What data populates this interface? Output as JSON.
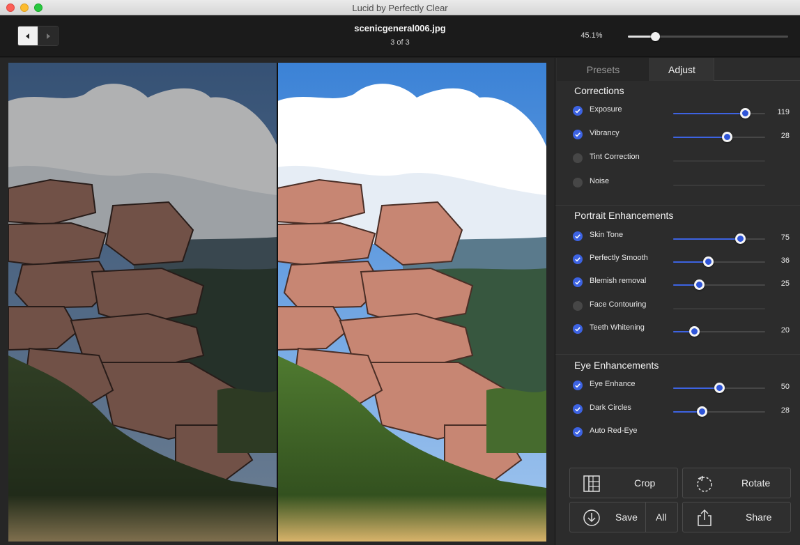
{
  "window": {
    "title": "Lucid by Perfectly Clear"
  },
  "toolbar": {
    "file_name": "scenicgeneral006.jpg",
    "file_count": "3 of 3",
    "zoom_label": "45.1%",
    "zoom_fraction": 0.17
  },
  "tabs": [
    {
      "label": "Presets",
      "active": false
    },
    {
      "label": "Adjust",
      "active": true
    }
  ],
  "sections": {
    "corrections": {
      "title": "Corrections",
      "items": [
        {
          "label": "Exposure",
          "enabled": true,
          "value": "119",
          "fraction": 0.78
        },
        {
          "label": "Vibrancy",
          "enabled": true,
          "value": "28",
          "fraction": 0.58
        },
        {
          "label": "Tint Correction",
          "enabled": false
        },
        {
          "label": "Noise",
          "enabled": false
        }
      ]
    },
    "portrait": {
      "title": "Portrait Enhancements",
      "items": [
        {
          "label": "Skin Tone",
          "enabled": true,
          "value": "75",
          "fraction": 0.73
        },
        {
          "label": "Perfectly Smooth",
          "enabled": true,
          "value": "36",
          "fraction": 0.38
        },
        {
          "label": "Blemish removal",
          "enabled": true,
          "value": "25",
          "fraction": 0.28
        },
        {
          "label": "Face Contouring",
          "enabled": false
        },
        {
          "label": "Teeth Whitening",
          "enabled": true,
          "value": "20",
          "fraction": 0.23
        }
      ]
    },
    "eye": {
      "title": "Eye Enhancements",
      "items": [
        {
          "label": "Eye Enhance",
          "enabled": true,
          "value": "50",
          "fraction": 0.5
        },
        {
          "label": "Dark Circles",
          "enabled": true,
          "value": "28",
          "fraction": 0.31
        },
        {
          "label": "Auto Red-Eye",
          "enabled": true
        }
      ]
    }
  },
  "actions": {
    "crop": "Crop",
    "rotate": "Rotate",
    "save": "Save",
    "save_all": "All",
    "share": "Share"
  },
  "colors": {
    "accent": "#3d63e2",
    "panel": "#2c2c2c",
    "toolbar": "#1b1b1b"
  },
  "icons": {
    "prev": "chevron-left-icon",
    "next": "chevron-right-icon",
    "crop": "crop-icon",
    "rotate": "rotate-icon",
    "save": "download-icon",
    "share": "share-icon",
    "check": "checkmark-icon"
  }
}
